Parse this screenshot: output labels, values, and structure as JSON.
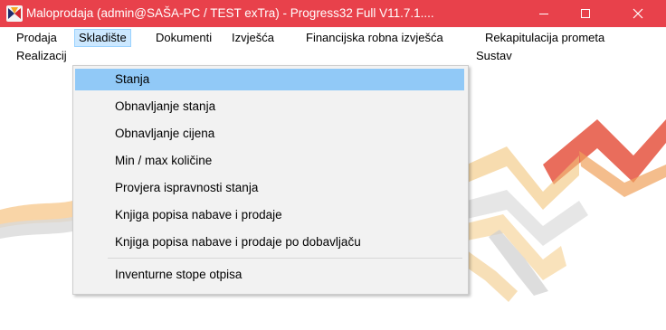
{
  "window": {
    "title": "Maloprodaja (admin@SAŠA-PC / TEST exTra) - Progress32 Full V11.7.1...."
  },
  "colors": {
    "titlebar": "#e8414b",
    "menu_highlight": "#91c9f7",
    "menu_bg": "#f2f2f2"
  },
  "icons": {
    "app": "app-logo-icon",
    "minimize": "minimize-icon",
    "maximize": "maximize-icon",
    "close": "close-icon"
  },
  "menubar": {
    "row1": [
      "Prodaja",
      "Skladište",
      "Dokumenti",
      "Izvješća",
      "Financijska robna izvješća",
      "Rekapitulacija prometa"
    ],
    "row2": [
      "Realizacij",
      "Sustav"
    ],
    "active": "Skladište"
  },
  "dropdown": {
    "items": [
      "Stanja",
      "Obnavljanje stanja",
      "Obnavljanje cijena",
      "Min / max količine",
      "Provjera ispravnosti stanja",
      "Knjiga popisa nabave i prodaje",
      "Knjiga popisa nabave i prodaje po dobavljaču",
      "Inventurne stope otpisa"
    ],
    "highlighted": "Stanja"
  }
}
